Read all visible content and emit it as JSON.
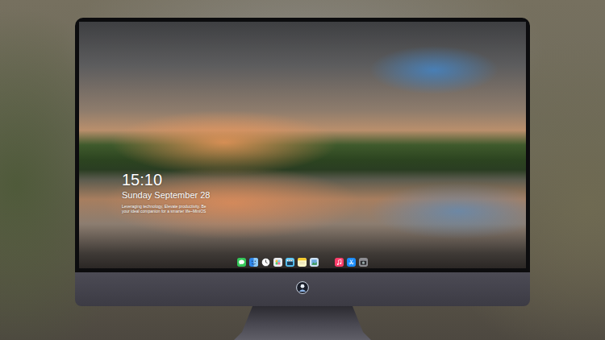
{
  "screen": {
    "lock": {
      "time": "15:10",
      "date": "Sunday September 28",
      "tagline": [
        "Leveraging technology, Elevate productivity. Be",
        "your ideal companion for a smarter life~MiniOS"
      ]
    },
    "dock": {
      "groups": [
        [
          {
            "kind": "messages"
          },
          {
            "kind": "finder"
          },
          {
            "kind": "clock"
          },
          {
            "kind": "photos"
          },
          {
            "kind": "clapper"
          },
          {
            "kind": "notes"
          },
          {
            "kind": "preview"
          }
        ],
        [
          {
            "kind": "music"
          },
          {
            "kind": "appstore"
          },
          {
            "kind": "camera"
          }
        ]
      ]
    }
  }
}
